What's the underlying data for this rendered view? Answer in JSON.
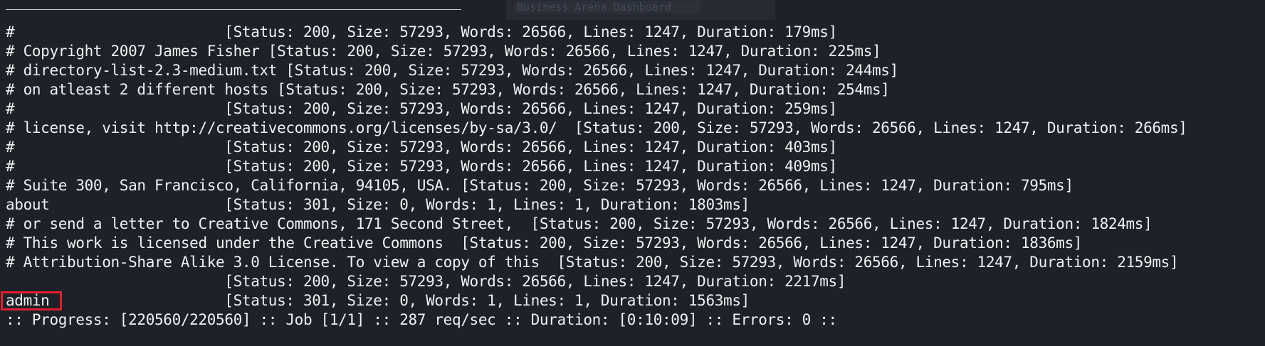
{
  "window": {
    "faded_title": "Business Arena Dashboard"
  },
  "terminal": {
    "separator": "____________________________________________________",
    "output_lines": [
      "#                        [Status: 200, Size: 57293, Words: 26566, Lines: 1247, Duration: 179ms]",
      "# Copyright 2007 James Fisher [Status: 200, Size: 57293, Words: 26566, Lines: 1247, Duration: 225ms]",
      "# directory-list-2.3-medium.txt [Status: 200, Size: 57293, Words: 26566, Lines: 1247, Duration: 244ms]",
      "# on atleast 2 different hosts [Status: 200, Size: 57293, Words: 26566, Lines: 1247, Duration: 254ms]",
      "#                        [Status: 200, Size: 57293, Words: 26566, Lines: 1247, Duration: 259ms]",
      "# license, visit http://creativecommons.org/licenses/by-sa/3.0/  [Status: 200, Size: 57293, Words: 26566, Lines: 1247, Duration: 266ms]",
      "#                        [Status: 200, Size: 57293, Words: 26566, Lines: 1247, Duration: 403ms]",
      "#                        [Status: 200, Size: 57293, Words: 26566, Lines: 1247, Duration: 409ms]",
      "# Suite 300, San Francisco, California, 94105, USA. [Status: 200, Size: 57293, Words: 26566, Lines: 1247, Duration: 795ms]",
      "about                    [Status: 301, Size: 0, Words: 1, Lines: 1, Duration: 1803ms]",
      "# or send a letter to Creative Commons, 171 Second Street,  [Status: 200, Size: 57293, Words: 26566, Lines: 1247, Duration: 1824ms]",
      "# This work is licensed under the Creative Commons  [Status: 200, Size: 57293, Words: 26566, Lines: 1247, Duration: 1836ms]",
      "# Attribution-Share Alike 3.0 License. To view a copy of this  [Status: 200, Size: 57293, Words: 26566, Lines: 1247, Duration: 2159ms]",
      "                         [Status: 200, Size: 57293, Words: 26566, Lines: 1247, Duration: 2217ms]",
      "admin                    [Status: 301, Size: 0, Words: 1, Lines: 1, Duration: 1563ms]"
    ],
    "progress_line": ":: Progress: [220560/220560] :: Job [1/1] :: 287 req/sec :: Duration: [0:10:09] :: Errors: 0 ::"
  },
  "colors": {
    "background": "#1e2128",
    "foreground": "#eef0f3",
    "highlight": "#e11f2f"
  }
}
